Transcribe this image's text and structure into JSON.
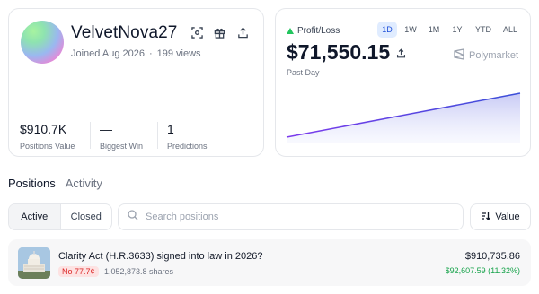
{
  "profile": {
    "username": "VelvetNova27",
    "joined": "Joined Aug 2026",
    "views": "199 views",
    "icons": [
      "scan-icon",
      "gift-icon",
      "share-icon"
    ],
    "stats": [
      {
        "value": "$910.7K",
        "label": "Positions Value"
      },
      {
        "value": "—",
        "label": "Biggest Win"
      },
      {
        "value": "1",
        "label": "Predictions"
      }
    ]
  },
  "pnl": {
    "label": "Profit/Loss",
    "ranges": [
      "1D",
      "1W",
      "1M",
      "1Y",
      "YTD",
      "ALL"
    ],
    "active_range": "1D",
    "value": "$71,550.15",
    "period": "Past Day",
    "brand": "Polymarket",
    "trend": "up",
    "accent": "#5b5bd6"
  },
  "tabs": {
    "positions": "Positions",
    "activity": "Activity",
    "active": "Positions"
  },
  "filter": {
    "active": "Active",
    "closed": "Closed",
    "selected": "Active"
  },
  "search": {
    "placeholder": "Search positions",
    "value": ""
  },
  "sort": {
    "label": "Value"
  },
  "positions": [
    {
      "title": "Clarity Act (H.R.3633) signed into law in 2026?",
      "outcome": "No 77.7¢",
      "shares": "1,052,873.8 shares",
      "value": "$910,735.86",
      "gain": "$92,607.59 (11.32%)",
      "image": "capitol-building"
    }
  ]
}
